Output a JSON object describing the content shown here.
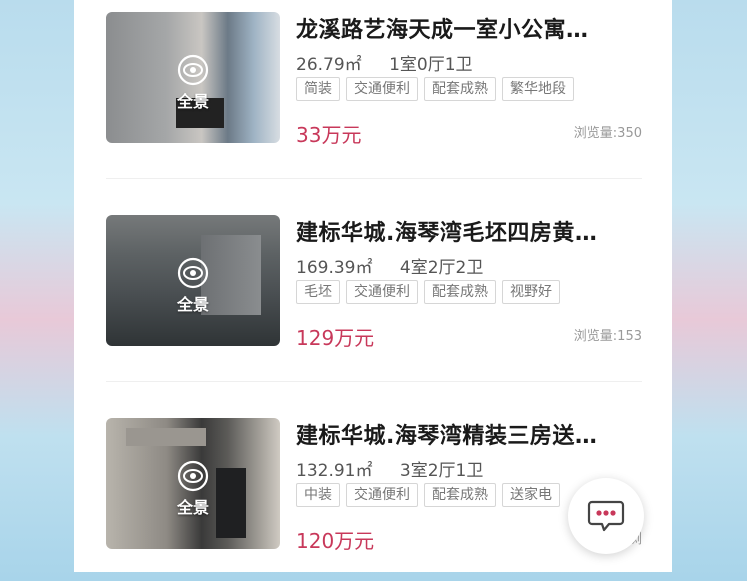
{
  "listings": [
    {
      "title": "龙溪路艺海天成一室小公寓…",
      "area": "26.79㎡",
      "layout": "1室0厅1卫",
      "tags": [
        "简装",
        "交通便利",
        "配套成熟",
        "繁华地段"
      ],
      "price": "33万元",
      "views": "浏览量:350",
      "pano_label": "全景"
    },
    {
      "title": "建标华城.海琴湾毛坯四房黄…",
      "area": "169.39㎡",
      "layout": "4室2厅2卫",
      "tags": [
        "毛坯",
        "交通便利",
        "配套成熟",
        "视野好"
      ],
      "price": "129万元",
      "views": "浏览量:153",
      "pano_label": "全景"
    },
    {
      "title": "建标华城.海琴湾精装三房送…",
      "area": "132.91㎡",
      "layout": "3室2厅1卫",
      "tags": [
        "中装",
        "交通便利",
        "配套成熟",
        "送家电"
      ],
      "price": "120万元",
      "views": "浏",
      "pano_label": "全景"
    }
  ],
  "icons": {
    "panorama": "panorama-eye-icon",
    "chat": "chat-bubble-icon"
  },
  "colors": {
    "price": "#c8385a",
    "chat_dots": "#c8385a"
  }
}
